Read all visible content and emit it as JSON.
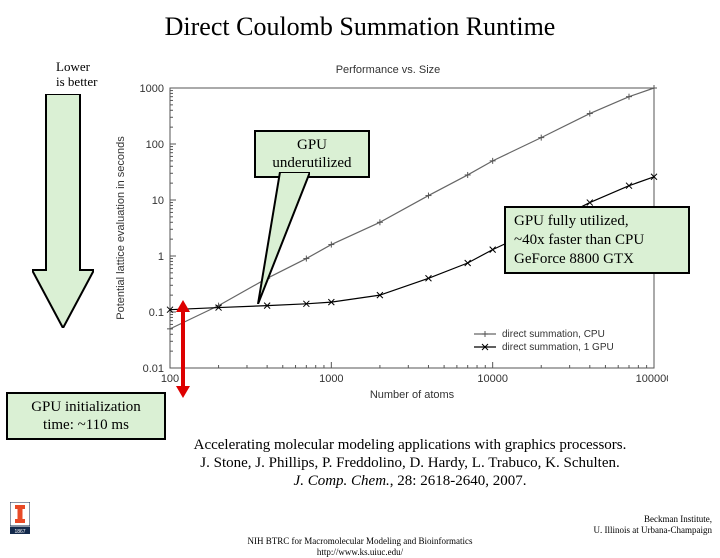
{
  "title": "Direct Coulomb Summation Runtime",
  "lower_label_1": "Lower",
  "lower_label_2": "is better",
  "callouts": {
    "underutilized": "GPU\nunderutilized",
    "fully": "GPU fully utilized,\n~40x faster than CPU\nGeForce 8800 GTX",
    "init": "GPU initialization\ntime: ~110 ms"
  },
  "chart_data": {
    "type": "line",
    "title": "Performance vs. Size",
    "xlabel": "Number of atoms",
    "ylabel": "Potential lattice evaluation in seconds",
    "xscale": "log",
    "yscale": "log",
    "xlim": [
      100,
      100000
    ],
    "ylim": [
      0.01,
      1000
    ],
    "xticks": [
      100,
      1000,
      10000,
      100000
    ],
    "yticks": [
      0.01,
      0.1,
      1,
      10,
      100,
      1000
    ],
    "legend_pos": "lower-right",
    "series": [
      {
        "name": "direct summation, CPU",
        "x": [
          100,
          200,
          400,
          700,
          1000,
          2000,
          4000,
          7000,
          10000,
          20000,
          40000,
          70000,
          100000
        ],
        "y": [
          0.05,
          0.13,
          0.4,
          0.9,
          1.6,
          4.0,
          12,
          28,
          50,
          130,
          350,
          700,
          1000
        ]
      },
      {
        "name": "direct summation, 1 GPU",
        "x": [
          100,
          200,
          400,
          700,
          1000,
          2000,
          4000,
          7000,
          10000,
          20000,
          40000,
          70000,
          100000
        ],
        "y": [
          0.11,
          0.12,
          0.13,
          0.14,
          0.15,
          0.2,
          0.4,
          0.75,
          1.3,
          3.3,
          9,
          18,
          26
        ]
      }
    ]
  },
  "citation": {
    "line1": "Accelerating molecular modeling applications with graphics processors.",
    "line2": "J. Stone, J. Phillips, P. Freddolino, D. Hardy, L. Trabuco, K. Schulten.",
    "line3_journal": "J. Comp. Chem.",
    "line3_rest": ", 28: 2618-2640, 2007."
  },
  "footer": {
    "center1": "NIH BTRC for Macromolecular Modeling and Bioinformatics",
    "center2": "http://www.ks.uiuc.edu/",
    "right1": "Beckman Institute,",
    "right2": "U. Illinois at Urbana-Champaign"
  }
}
